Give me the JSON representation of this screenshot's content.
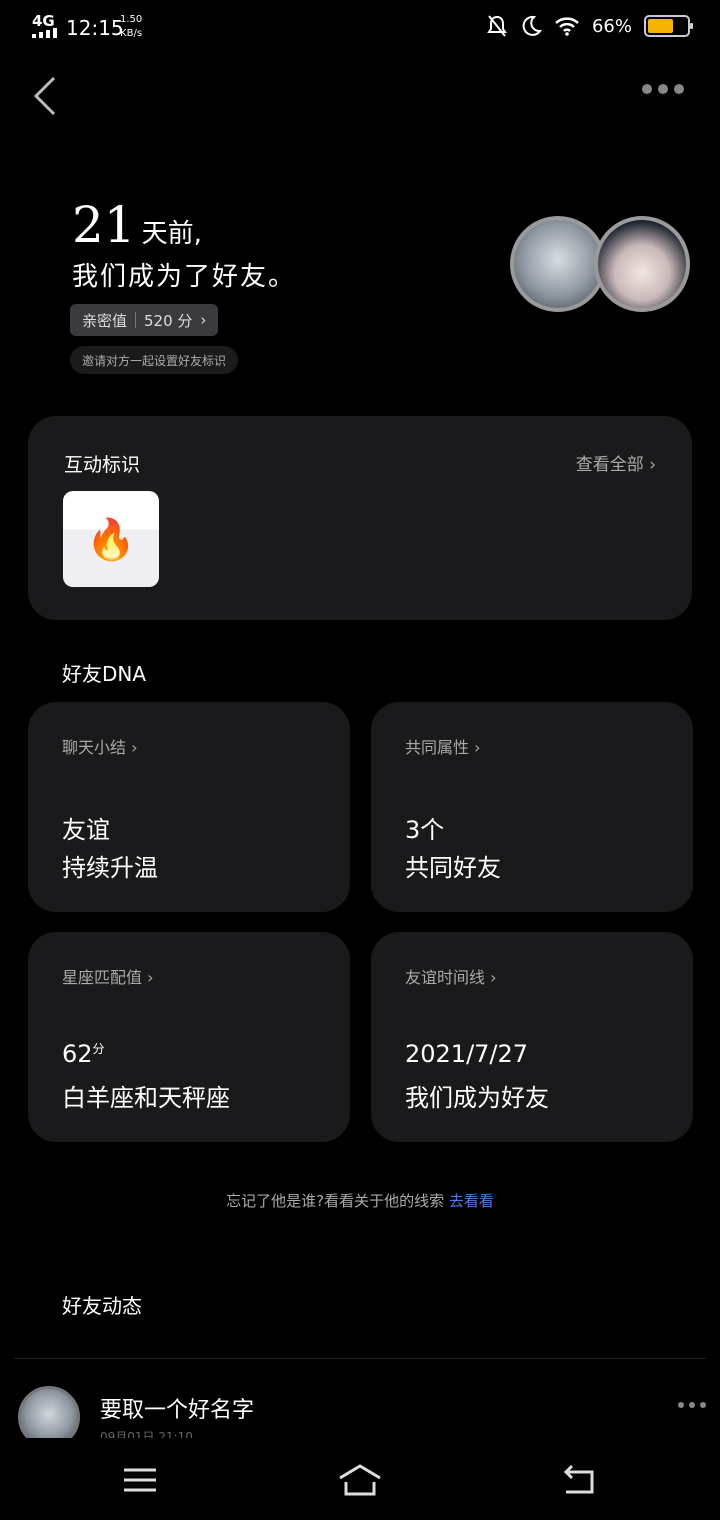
{
  "status_bar": {
    "network": "4G",
    "time": "12:15",
    "speed_value": "1.50",
    "speed_unit": "KB/s",
    "battery": "66%",
    "battery_level": 0.66,
    "icons": [
      "mute-icon",
      "moon-icon",
      "wifi-icon",
      "battery-icon"
    ]
  },
  "header": {
    "back_icon": "back-arrow-icon",
    "more_icon": "more-icon"
  },
  "hero": {
    "days": "21",
    "days_suffix": "天前,",
    "line2": "我们成为了好友。",
    "intimacy_label": "亲密值",
    "intimacy_value": "520 分",
    "hint": "邀请对方一起设置好友标识"
  },
  "interaction": {
    "title": "互动标识",
    "view_all": "查看全部",
    "badge_icon": "flame-icon"
  },
  "dna": {
    "title": "好友DNA",
    "cards": [
      {
        "label": "聊天小结",
        "line1": "友谊",
        "line2": "持续升温"
      },
      {
        "label": "共同属性",
        "line1": "3个",
        "line2": "共同好友"
      },
      {
        "label": "星座匹配值",
        "line1": "62",
        "line1_sup": "分",
        "line2": "白羊座和天秤座"
      },
      {
        "label": "友谊时间线",
        "line1": "2021/7/27",
        "line2": "我们成为好友"
      }
    ]
  },
  "forget": {
    "text": "忘记了他是谁?看看关于他的线索",
    "link": "去看看"
  },
  "feed": {
    "title": "好友动态",
    "post_name": "要取一个好名字",
    "post_sub": "09月01日 21:10"
  }
}
